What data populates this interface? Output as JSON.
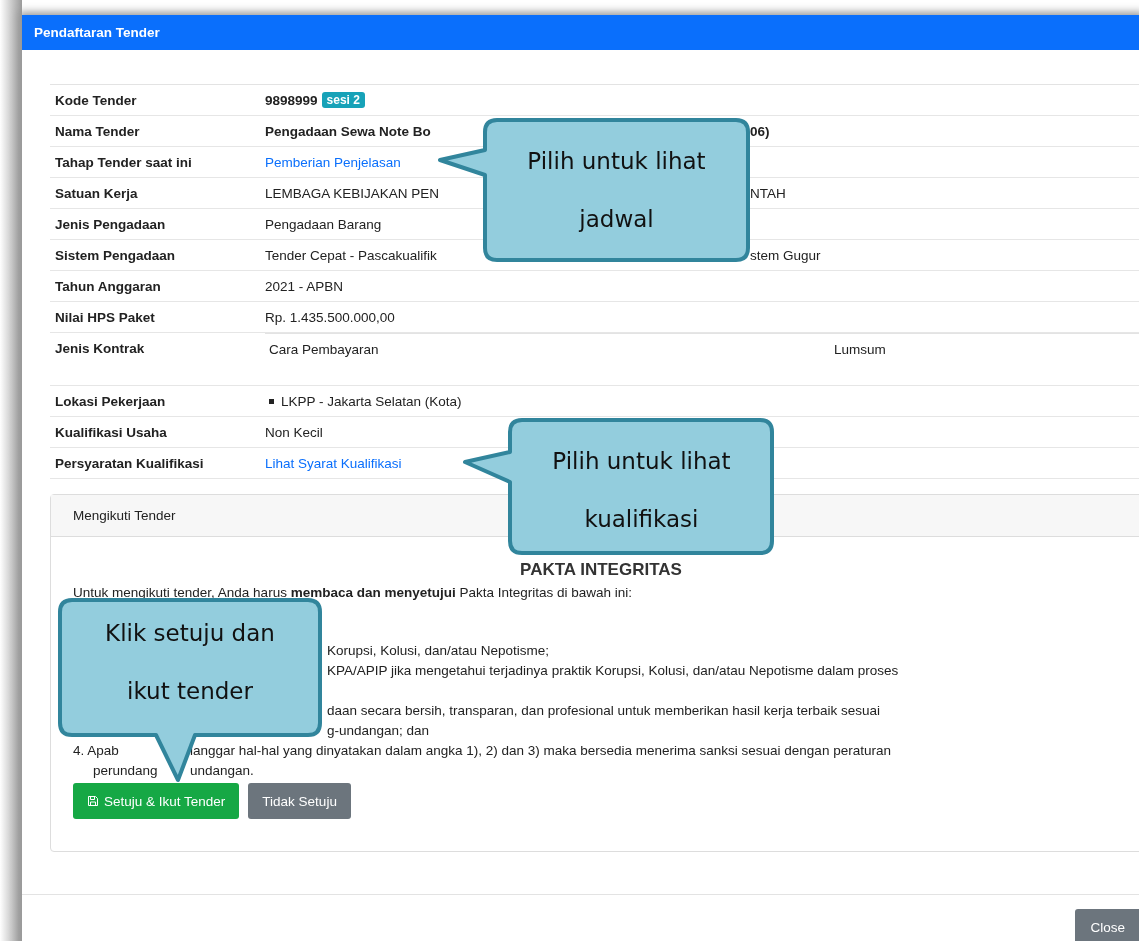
{
  "dialog": {
    "title": "Pendaftaran Tender"
  },
  "details": [
    {
      "label": "Kode Tender",
      "kind": "bold",
      "parts": [
        "9898999"
      ],
      "badge": "sesi 2"
    },
    {
      "label": "Nama Tender",
      "kind": "bold",
      "parts": [
        "Pengadaan Sewa Note Bo",
        "06)"
      ]
    },
    {
      "label": "Tahap Tender saat ini",
      "kind": "link",
      "parts": [
        "Pemberian Penjelasan"
      ]
    },
    {
      "label": "Satuan Kerja",
      "kind": "text",
      "parts": [
        "LEMBAGA KEBIJAKAN PEN",
        "NTAH"
      ]
    },
    {
      "label": "Jenis Pengadaan",
      "kind": "text",
      "parts": [
        "Pengadaan Barang"
      ]
    },
    {
      "label": "Sistem Pengadaan",
      "kind": "text",
      "parts": [
        "Tender Cepat - Pascakualifik",
        "stem Gugur"
      ]
    },
    {
      "label": "Tahun Anggaran",
      "kind": "text",
      "parts": [
        "2021 - APBN"
      ]
    },
    {
      "label": "Nilai HPS Paket",
      "kind": "text",
      "parts": [
        "Rp. 1.435.500.000,00"
      ]
    },
    {
      "label": "Jenis Kontrak",
      "kind": "contract",
      "parts": [
        "Cara Pembayaran",
        "Lumsum"
      ]
    },
    {
      "label": "Lokasi Pekerjaan",
      "kind": "bullets",
      "parts": [
        "LKPP - Jakarta Selatan (Kota)"
      ]
    },
    {
      "label": "Kualifikasi Usaha",
      "kind": "text",
      "parts": [
        "Non Kecil"
      ]
    },
    {
      "label": "Persyaratan Kualifikasi",
      "kind": "link",
      "parts": [
        "Lihat Syarat Kualifikasi"
      ]
    }
  ],
  "panel": {
    "title": "Mengikuti Tender",
    "heading": "PAKTA INTEGRITAS",
    "lines": [
      {
        "kind": "full",
        "parts": [
          "Untuk mengikuti tender, Anda harus **membaca dan menyetujui** Pakta Integritas di bawah ini:"
        ]
      },
      {
        "kind": "after_callout",
        "parts": [
          "Korupsi, Kolusi, dan/atau Nepotisme;"
        ]
      },
      {
        "kind": "after_callout",
        "parts": [
          "KPA/APIP jika mengetahui terjadinya praktik Korupsi, Kolusi, dan/atau Nepotisme dalam proses"
        ]
      },
      {
        "kind": "after_callout",
        "parts": [
          "daan secara bersih, transparan, dan profesional untuk memberikan hasil kerja terbaik sesuai"
        ]
      },
      {
        "kind": "after_callout",
        "parts": [
          "g-undangan; dan"
        ]
      },
      {
        "kind": "split",
        "parts": [
          "4. Apab",
          "langgar hal-hal yang dinyatakan dalam angka 1), 2) dan 3) maka bersedia menerima sanksi sesuai dengan peraturan"
        ]
      },
      {
        "kind": "split",
        "parts": [
          "perundang",
          "undangan."
        ]
      }
    ],
    "buttons": [
      {
        "label": "Setuju & Ikut Tender",
        "kind": "primary"
      },
      {
        "label": "Tidak Setuju",
        "kind": "secondary"
      }
    ]
  },
  "footer": {
    "close": "Close"
  },
  "callouts": [
    {
      "text": "Pilih untuk lihat jadwal"
    },
    {
      "text": "Pilih untuk lihat kualifikasi"
    },
    {
      "text": "Klik setuju dan ikut tender"
    }
  ]
}
